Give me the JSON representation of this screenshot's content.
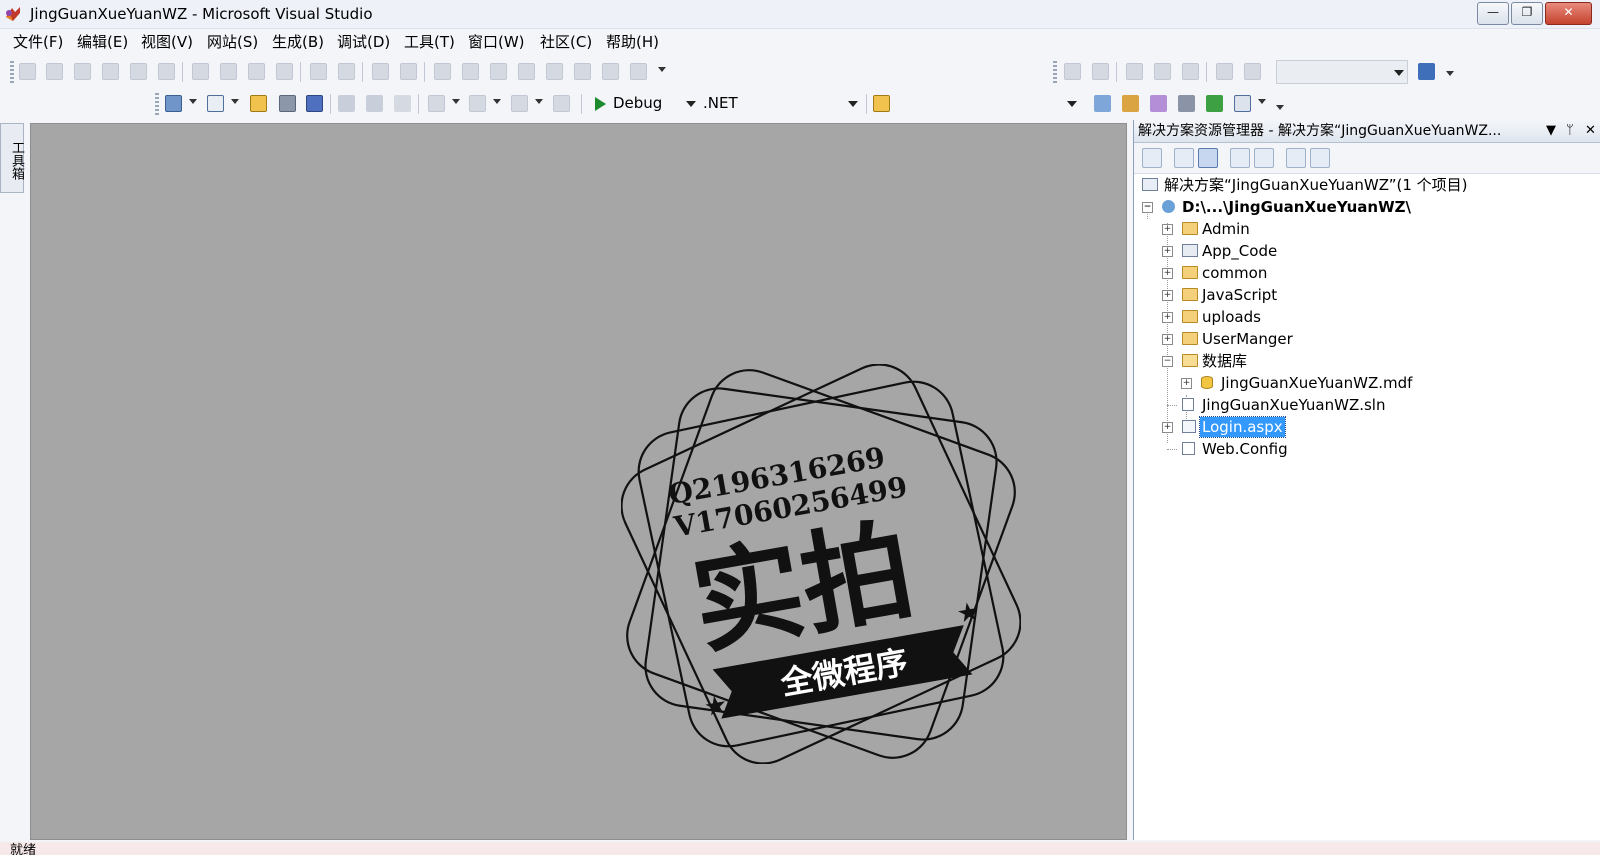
{
  "window": {
    "title": "JingGuanXueYuanWZ - Microsoft Visual Studio",
    "controls": {
      "minimize": "—",
      "maximize": "❐",
      "close": "✕"
    }
  },
  "menu": {
    "items": [
      "文件(F)",
      "编辑(E)",
      "视图(V)",
      "网站(S)",
      "生成(B)",
      "调试(D)",
      "工具(T)",
      "窗口(W)",
      "社区(C)",
      "帮助(H)"
    ]
  },
  "toolbar": {
    "configuration": "Debug",
    "platform": ".NET"
  },
  "toolbox": {
    "label": "工具箱"
  },
  "watermark": {
    "line1": "Q2196316269",
    "line2": "V17060256499",
    "main": "实拍",
    "banner": "全微程序"
  },
  "solution_explorer": {
    "title": "解决方案资源管理器 - 解决方案“JingGuanXueYuanWZ...",
    "pin_icon": "pin-icon",
    "close_icon": "close-icon",
    "tree": {
      "solution": "解决方案“JingGuanXueYuanWZ”(1 个项目)",
      "project": "D:\\...\\JingGuanXueYuanWZ\\",
      "items": [
        {
          "label": "Admin",
          "icon": "folder-icon",
          "expander": "+"
        },
        {
          "label": "App_Code",
          "icon": "special-folder-icon",
          "expander": "+"
        },
        {
          "label": "common",
          "icon": "folder-icon",
          "expander": "+"
        },
        {
          "label": "JavaScript",
          "icon": "folder-icon",
          "expander": "+"
        },
        {
          "label": "uploads",
          "icon": "folder-icon",
          "expander": "+"
        },
        {
          "label": "UserManger",
          "icon": "folder-icon",
          "expander": "+"
        },
        {
          "label": "数据库",
          "icon": "folder-open-icon",
          "expander": "−"
        },
        {
          "label": "JingGuanXueYuanWZ.mdf",
          "icon": "database-icon",
          "expander": "+"
        },
        {
          "label": "JingGuanXueYuanWZ.sln",
          "icon": "file-icon",
          "expander": ""
        },
        {
          "label": "Login.aspx",
          "icon": "aspx-file-icon",
          "expander": "+",
          "selected": true
        },
        {
          "label": "Web.Config",
          "icon": "config-file-icon",
          "expander": ""
        }
      ]
    }
  },
  "status": {
    "text": "就绪"
  },
  "colors": {
    "editor_bg": "#a6a6a6",
    "selection": "#3399ff",
    "title_bg": "#eef2f8"
  }
}
